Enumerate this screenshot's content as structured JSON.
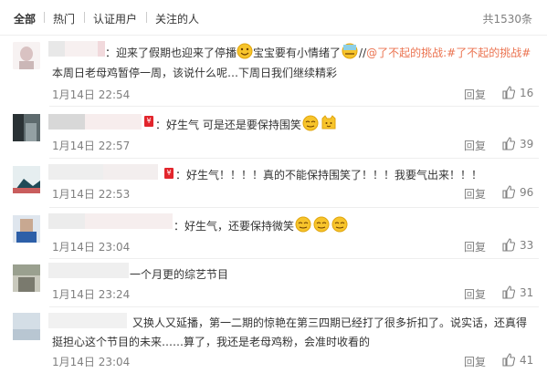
{
  "tabs": {
    "all": "全部",
    "hot": "热门",
    "verified": "认证用户",
    "following": "关注的人"
  },
  "total_count": "共1530条",
  "reply_label": "回复",
  "comments": [
    {
      "text_pre": "：迎来了假期也迎来了停播",
      "text_mid": "宝宝要有小情绪了",
      "text_sep": "//",
      "topic1": "@了不起的挑战",
      "topic2": ":#了不起的挑战#",
      "text_line2": "本周日老母鸡暂停一周，该说什么呢…下周日我们继续精彩",
      "time": "1月14日 22:54",
      "likes": "16"
    },
    {
      "text": "：好生气 可是还是要保持围笑",
      "time": "1月14日 22:57",
      "likes": "39"
    },
    {
      "text": "：好生气！！！！真的不能保持围笑了！！！我要气出来！！！",
      "time": "1月14日 22:53",
      "likes": "96"
    },
    {
      "text": "：好生气，还要保持微笑",
      "time": "1月14日 23:04",
      "likes": "33"
    },
    {
      "text": "一个月更的综艺节目",
      "time": "1月14日 23:24",
      "likes": "31"
    },
    {
      "text": "又换人又延播，第一二期的惊艳在第三四期已经打了很多折扣了。说实话，还真得",
      "text_line2": "挺担心这个节目的未来……算了，我还是老母鸡粉，会准时收看的",
      "time": "1月14日 23:04",
      "likes": "41"
    }
  ]
}
